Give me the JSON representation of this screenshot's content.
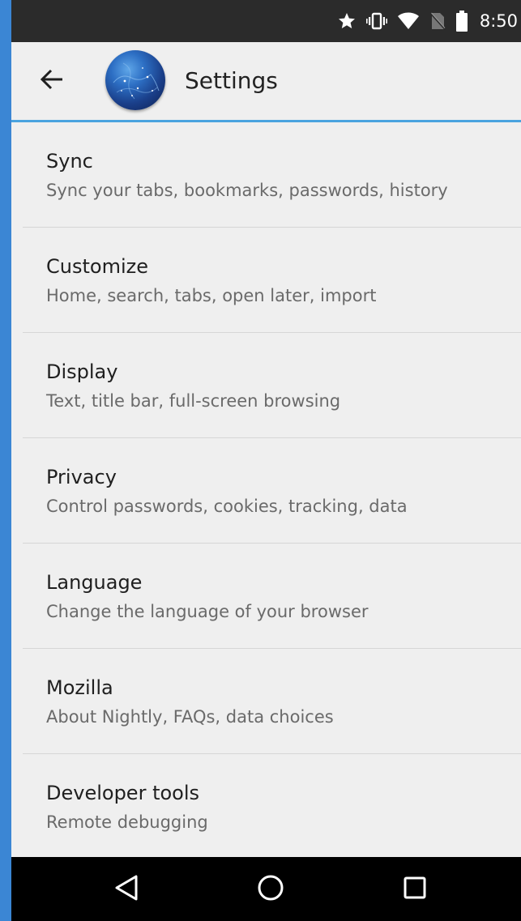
{
  "status_bar": {
    "time": "8:50",
    "icons": [
      "star-icon",
      "vibrate-icon",
      "wifi-icon",
      "no-sim-icon",
      "battery-icon"
    ]
  },
  "toolbar": {
    "back_icon": "arrow-left-icon",
    "logo": "nightly-globe-logo",
    "title": "Settings",
    "accent_color": "#4aa3df"
  },
  "settings": {
    "items": [
      {
        "title": "Sync",
        "summary": "Sync your tabs, bookmarks, passwords, history"
      },
      {
        "title": "Customize",
        "summary": "Home, search, tabs, open later, import"
      },
      {
        "title": "Display",
        "summary": "Text, title bar, full-screen browsing"
      },
      {
        "title": "Privacy",
        "summary": "Control passwords, cookies, tracking, data"
      },
      {
        "title": "Language",
        "summary": "Change the language of your browser"
      },
      {
        "title": "Mozilla",
        "summary": "About Nightly, FAQs, data choices"
      },
      {
        "title": "Developer tools",
        "summary": "Remote debugging"
      }
    ]
  },
  "nav_bar": {
    "buttons": [
      "back-triangle-icon",
      "home-circle-icon",
      "recents-square-icon"
    ]
  }
}
